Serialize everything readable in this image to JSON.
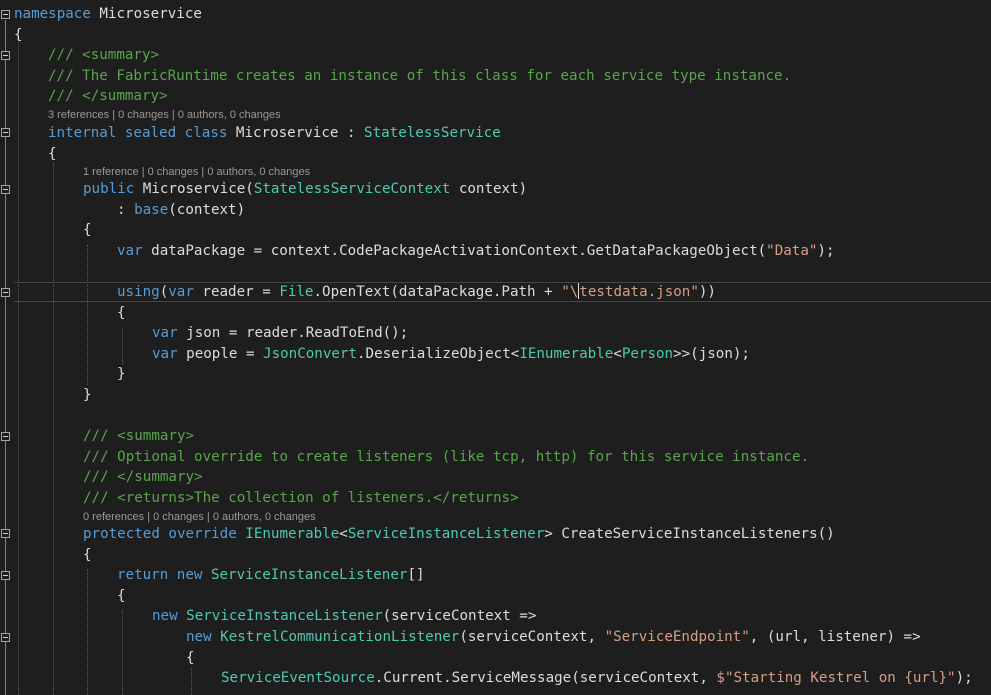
{
  "code": {
    "ns_kw": "namespace",
    "ns_name": " Microservice",
    "open0": "{",
    "sum1_open": "/// <summary>",
    "sum1_text": "/// The FabricRuntime creates an instance of this class for each service type instance.",
    "sum1_close": "/// </summary>",
    "lens1": "3 references | 0 changes | 0 authors, 0 changes",
    "class_kw": "internal sealed class",
    "class_name": " Microservice : ",
    "class_base": "StatelessService",
    "open1": "{",
    "lens2": "1 reference | 0 changes | 0 authors, 0 changes",
    "ctor_kw": "public",
    "ctor_name": " Microservice(",
    "ctor_ptype": "StatelessServiceContext",
    "ctor_param": " context)",
    "base_pre": ": ",
    "base_kw": "base",
    "base_arg": "(context)",
    "open2": "{",
    "dp_var": "var",
    "dp_rest": " dataPackage = context.CodePackageActivationContext.GetDataPackageObject(",
    "dp_str": "\"Data\"",
    "dp_end": ");",
    "using_kw": "using",
    "using_p": "(",
    "using_var": "var",
    "using_mid": " reader = ",
    "using_file": "File",
    "using_mid2": ".OpenText(dataPackage.Path + ",
    "using_str1": "\"\\",
    "using_str2": "testdata.json\"",
    "using_end": "))",
    "open3": "{",
    "json_var": "var",
    "json_rest": " json = reader.ReadToEnd();",
    "people_var": "var",
    "people_mid": " people = ",
    "people_jc": "JsonConvert",
    "people_mid2": ".DeserializeObject<",
    "people_ienum": "IEnumerable",
    "people_lt": "<",
    "people_person": "Person",
    "people_end": ">>(json);",
    "close3": "}",
    "close2": "}",
    "sum2_open": "/// <summary>",
    "sum2_text": "/// Optional override to create listeners (like tcp, http) for this service instance.",
    "sum2_close": "/// </summary>",
    "sum2_returns": "/// <returns>The collection of listeners.</returns>",
    "lens3": "0 references | 0 changes | 0 authors, 0 changes",
    "csil_kw": "protected override",
    "csil_sp": " ",
    "csil_ienum": "IEnumerable",
    "csil_lt": "<",
    "csil_sil": "ServiceInstanceListener",
    "csil_end": "> CreateServiceInstanceListeners()",
    "open4": "{",
    "ret_kw": "return new",
    "ret_sp": " ",
    "ret_type": "ServiceInstanceListener",
    "ret_end": "[]",
    "open5": "{",
    "new1_kw": "new",
    "new1_sp": " ",
    "new1_type": "ServiceInstanceListener",
    "new1_end": "(serviceContext =>",
    "new2_kw": "new",
    "new2_sp": " ",
    "new2_type": "KestrelCommunicationListener",
    "new2_mid": "(serviceContext, ",
    "new2_str": "\"ServiceEndpoint\"",
    "new2_end": ", (url, listener) =>",
    "open6": "{",
    "ses_type": "ServiceEventSource",
    "ses_mid": ".Current.ServiceMessage(serviceContext, ",
    "ses_str": "$\"Starting Kestrel on {url}\"",
    "ses_end": ");"
  },
  "colors": {
    "background": "#1e1e1e",
    "keyword": "#569cd6",
    "comment": "#57a64a",
    "type": "#4ec9b0",
    "string": "#d69d85",
    "text": "#dcdcdc",
    "codelens": "#999999"
  }
}
